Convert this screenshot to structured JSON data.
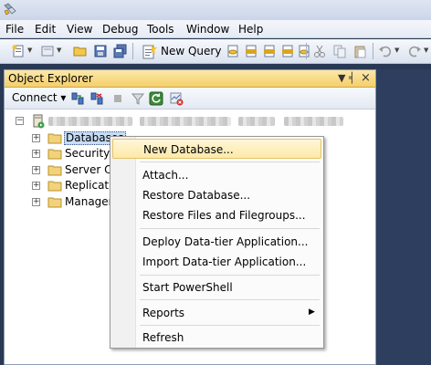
{
  "menubar": {
    "items": [
      "File",
      "Edit",
      "View",
      "Debug",
      "Tools",
      "Window",
      "Help"
    ]
  },
  "toolbar": {
    "new_query_label": "New Query"
  },
  "object_explorer": {
    "title": "Object Explorer",
    "pin_glyph": "▼ ╡",
    "close_glyph": "×",
    "connect_label": "Connect ▾",
    "tree": {
      "items": [
        "Databases",
        "Security",
        "Server Ob",
        "Replicatio",
        "Managem"
      ]
    }
  },
  "context_menu": {
    "items": [
      "New Database...",
      "Attach...",
      "Restore Database...",
      "Restore Files and Filegroups...",
      "Deploy Data-tier Application...",
      "Import Data-tier Application...",
      "Start PowerShell",
      "Reports",
      "Refresh"
    ],
    "submenu_arrow": "▶"
  },
  "colors": {
    "background": "#293955",
    "highlight": "#fde9a9",
    "title_active": "#f5cf6a"
  }
}
